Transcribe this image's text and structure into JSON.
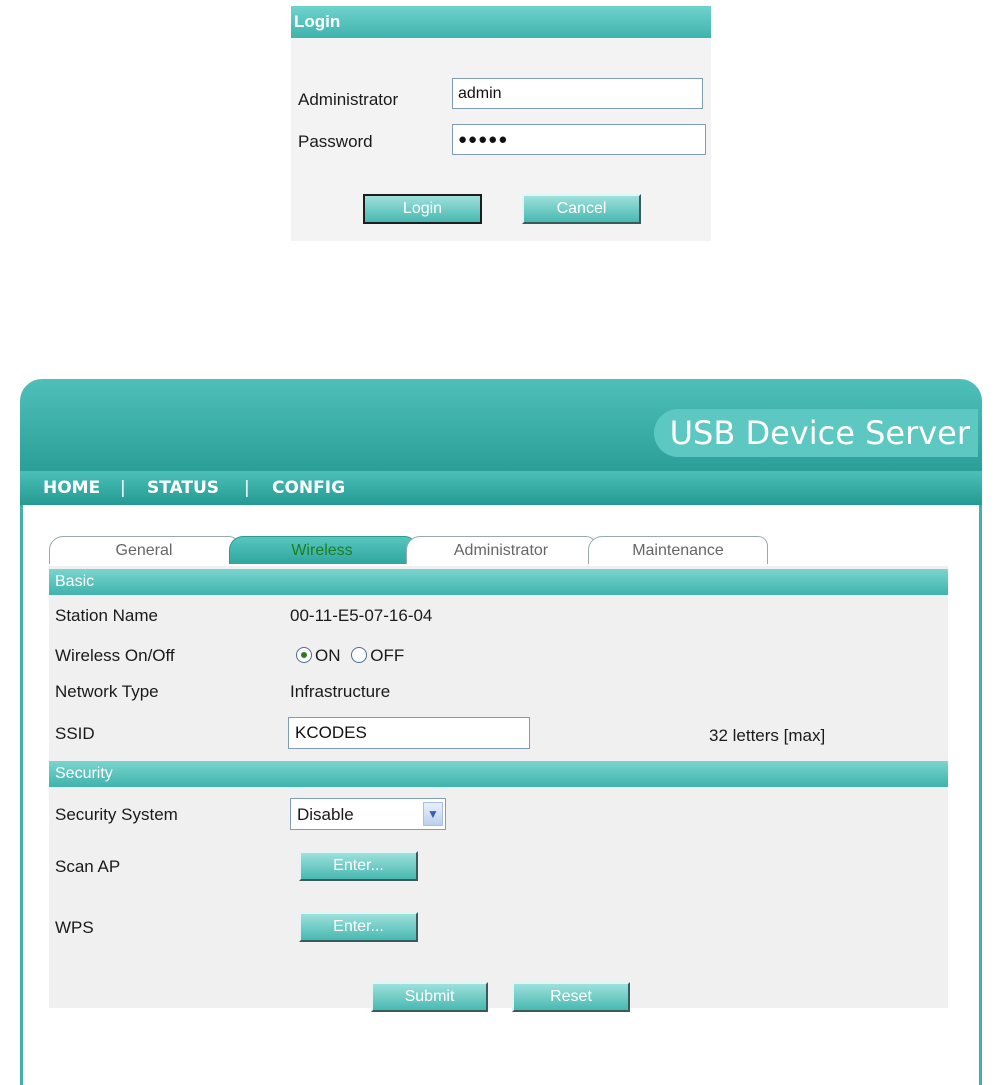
{
  "login": {
    "title": "Login",
    "admin_label": "Administrator",
    "admin_value": "admin",
    "password_label": "Password",
    "password_value": "●●●●●",
    "login_button": "Login",
    "cancel_button": "Cancel"
  },
  "app": {
    "brand": "USB Device Server",
    "nav": [
      {
        "label": "HOME"
      },
      {
        "label": "STATUS"
      },
      {
        "label": "CONFIG"
      }
    ],
    "nav_separator": "|"
  },
  "tabs": [
    {
      "label": "General",
      "active": false
    },
    {
      "label": "Wireless",
      "active": true
    },
    {
      "label": "Administrator",
      "active": false
    },
    {
      "label": "Maintenance",
      "active": false
    }
  ],
  "basic": {
    "header": "Basic",
    "station_name_label": "Station Name",
    "station_name_value": "00-11-E5-07-16-04",
    "wireless_label": "Wireless On/Off",
    "wireless_on": "ON",
    "wireless_off": "OFF",
    "wireless_selected": "ON",
    "network_type_label": "Network Type",
    "network_type_value": "Infrastructure",
    "ssid_label": "SSID",
    "ssid_value": "KCODES",
    "ssid_hint": "32 letters [max]"
  },
  "security": {
    "header": "Security",
    "system_label": "Security System",
    "system_value": "Disable",
    "scan_ap_label": "Scan AP",
    "scan_ap_button": "Enter...",
    "wps_label": "WPS",
    "wps_button": "Enter..."
  },
  "actions": {
    "submit": "Submit",
    "reset": "Reset"
  },
  "colors": {
    "accent": "#3fb3ab",
    "accent_light": "#7ad5cf",
    "panel_bg": "#f0f0f0"
  }
}
